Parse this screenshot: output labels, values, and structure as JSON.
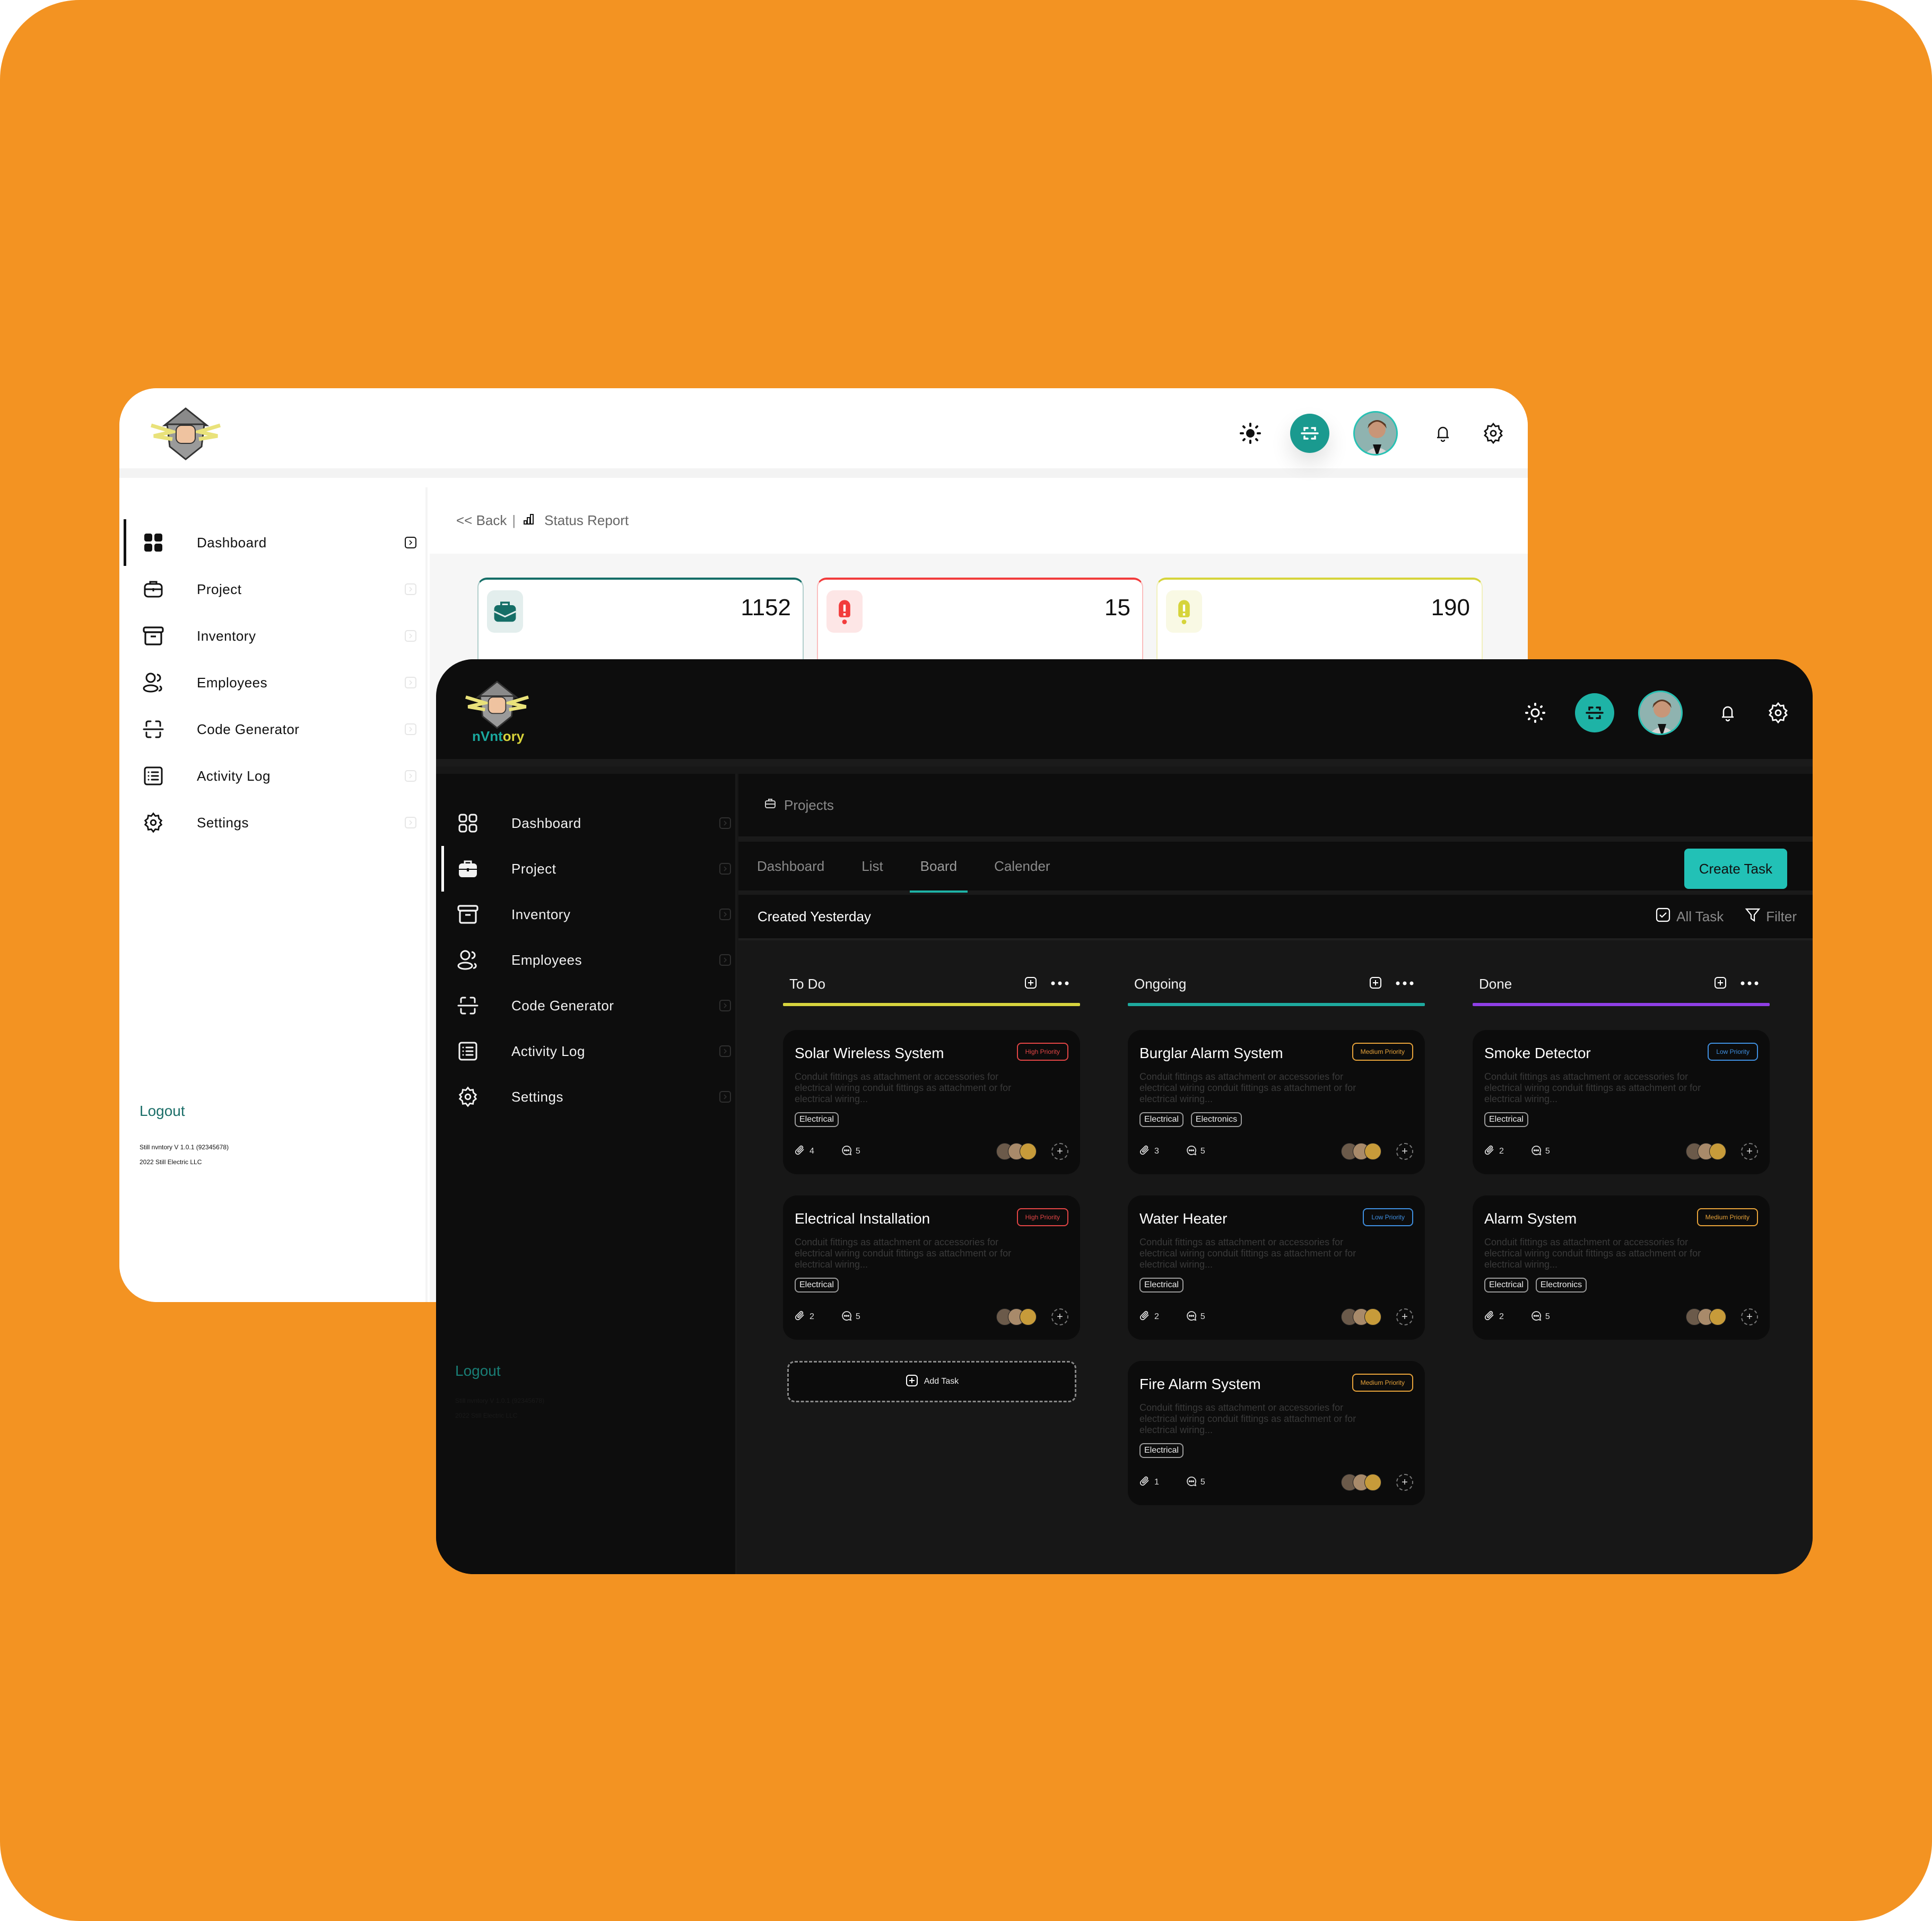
{
  "background_color": "#F39322",
  "light_window": {
    "header": {
      "icons": [
        "sun-icon",
        "scan-icon",
        "avatar",
        "bell-icon",
        "gear-icon"
      ]
    },
    "sidebar": {
      "items": [
        {
          "label": "Dashboard",
          "icon": "dashboard-grid-icon",
          "active": true
        },
        {
          "label": "Project",
          "icon": "briefcase-icon",
          "active": false
        },
        {
          "label": "Inventory",
          "icon": "archive-box-icon",
          "active": false
        },
        {
          "label": "Employees",
          "icon": "users-icon",
          "active": false
        },
        {
          "label": "Code Generator",
          "icon": "scan-code-icon",
          "active": false
        },
        {
          "label": "Activity Log",
          "icon": "list-icon",
          "active": false
        },
        {
          "label": "Settings",
          "icon": "gear-icon",
          "active": false
        }
      ],
      "logout": "Logout",
      "version": "Still nvntory V 1.0.1 (92345678)",
      "copyright": "2022 Still Electric LLC"
    },
    "breadcrumb": {
      "back": "<< Back",
      "separator": "|",
      "current": "Status Report"
    },
    "stats": [
      {
        "value": "1152",
        "icon": "briefcase-icon",
        "color": "#156e67"
      },
      {
        "value": "15",
        "icon": "alert-icon",
        "color": "#f23c3c"
      },
      {
        "value": "190",
        "icon": "alert-icon",
        "color": "#d6d43b"
      }
    ]
  },
  "dark_window": {
    "brand": {
      "part1": "nVnt",
      "part2": "ory",
      "color1": "#1aa99f",
      "color2": "#d8d33a"
    },
    "header": {
      "icons": [
        "sun-icon",
        "scan-icon",
        "avatar",
        "bell-icon",
        "gear-icon"
      ]
    },
    "sidebar": {
      "items": [
        {
          "label": "Dashboard",
          "icon": "dashboard-grid-icon",
          "active": false
        },
        {
          "label": "Project",
          "icon": "briefcase-icon",
          "active": true
        },
        {
          "label": "Inventory",
          "icon": "archive-box-icon",
          "active": false
        },
        {
          "label": "Employees",
          "icon": "users-icon",
          "active": false
        },
        {
          "label": "Code Generator",
          "icon": "scan-code-icon",
          "active": false
        },
        {
          "label": "Activity Log",
          "icon": "list-icon",
          "active": false
        },
        {
          "label": "Settings",
          "icon": "gear-icon",
          "active": false
        }
      ],
      "logout": "Logout",
      "version": "Still nvntory V 1.0.1 (92345678)",
      "copyright": "2022 Still Electric LLC"
    },
    "breadcrumb": "Projects",
    "tabs": [
      {
        "label": "Dashboard",
        "active": false
      },
      {
        "label": "List",
        "active": false
      },
      {
        "label": "Board",
        "active": true
      },
      {
        "label": "Calender",
        "active": false
      }
    ],
    "create_task": "Create Task",
    "filter_bar": {
      "title": "Created Yesterday",
      "all_task": "All Task",
      "filter": "Filter"
    },
    "add_task": "Add Task",
    "columns": [
      {
        "name": "To Do",
        "color": "#d7d43e",
        "cards": [
          {
            "title": "Solar Wireless System",
            "priority": "High Priority",
            "priority_color": "#e24545",
            "description": "Conduit fittings as attachment or accessories for electrical wiring conduit fittings as attachment or for electrical wiring...",
            "tags": [
              "Electrical"
            ],
            "attachments": "4",
            "comments": "5"
          },
          {
            "title": "Electrical Installation",
            "priority": "High Priority",
            "priority_color": "#e24545",
            "description": "Conduit fittings as attachment or accessories for electrical wiring conduit fittings as attachment or for electrical wiring...",
            "tags": [
              "Electrical"
            ],
            "attachments": "2",
            "comments": "5"
          }
        ]
      },
      {
        "name": "Ongoing",
        "color": "#1eaa9f",
        "cards": [
          {
            "title": "Burglar Alarm System",
            "priority": "Medium Priority",
            "priority_color": "#e6a23a",
            "description": "Conduit fittings as attachment or accessories for electrical wiring conduit fittings as attachment or for electrical wiring...",
            "tags": [
              "Electrical",
              "Electronics"
            ],
            "attachments": "3",
            "comments": "5"
          },
          {
            "title": "Water Heater",
            "priority": "Low Priority",
            "priority_color": "#3f8fe0",
            "description": "Conduit fittings as attachment or accessories for electrical wiring conduit fittings as attachment or for electrical wiring...",
            "tags": [
              "Electrical"
            ],
            "attachments": "2",
            "comments": "5"
          },
          {
            "title": "Fire Alarm System",
            "priority": "Medium Priority",
            "priority_color": "#e6a23a",
            "description": "Conduit fittings as attachment or accessories for electrical wiring conduit fittings as attachment or for electrical wiring...",
            "tags": [
              "Electrical"
            ],
            "attachments": "1",
            "comments": "5"
          }
        ]
      },
      {
        "name": "Done",
        "color": "#8f3fe6",
        "cards": [
          {
            "title": "Smoke Detector",
            "priority": "Low Priority",
            "priority_color": "#3f8fe0",
            "description": "Conduit fittings as attachment or accessories for electrical wiring conduit fittings as attachment or for electrical wiring...",
            "tags": [
              "Electrical"
            ],
            "attachments": "2",
            "comments": "5"
          },
          {
            "title": "Alarm System",
            "priority": "Medium Priority",
            "priority_color": "#e6a23a",
            "description": "Conduit fittings as attachment or accessories for electrical wiring conduit fittings as attachment or for electrical wiring...",
            "tags": [
              "Electrical",
              "Electronics"
            ],
            "attachments": "2",
            "comments": "5"
          }
        ]
      }
    ]
  }
}
